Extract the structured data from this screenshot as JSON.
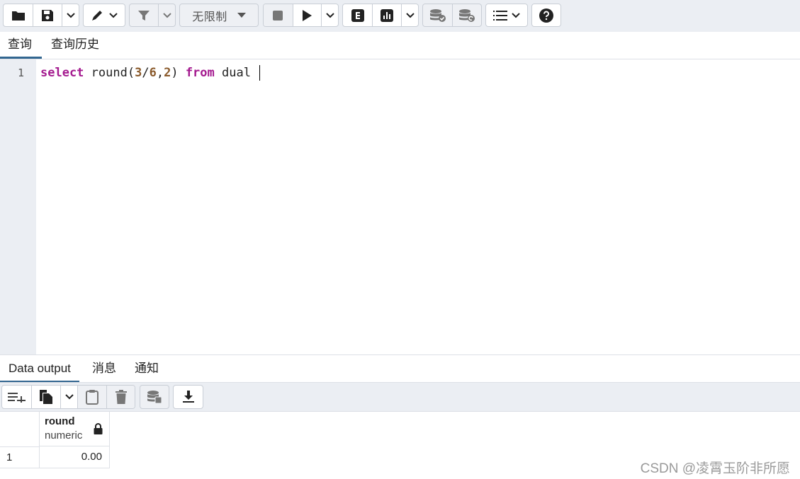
{
  "toolbar": {
    "limit_label": "无限制",
    "icons": [
      "folder-icon",
      "save-icon",
      "chevron-down-icon",
      "pencil-icon",
      "filter-icon",
      "stop-icon",
      "play-icon",
      "explain-icon",
      "analyze-icon",
      "commit-icon",
      "rollback-icon",
      "macros-icon",
      "help-icon"
    ]
  },
  "query_tabs": [
    {
      "label": "查询",
      "active": true
    },
    {
      "label": "查询历史",
      "active": false
    }
  ],
  "editor": {
    "line_number": "1",
    "tokens": {
      "kw_select": "select",
      "fn": " round(",
      "n1": "3",
      "slash": "/",
      "n2": "6",
      "comma": ",",
      "n3": "2",
      "close": ") ",
      "kw_from": "from",
      "table": " dual "
    }
  },
  "output_tabs": [
    {
      "label": "Data output",
      "active": true
    },
    {
      "label": "消息",
      "active": false
    },
    {
      "label": "通知",
      "active": false
    }
  ],
  "result": {
    "column": {
      "name": "round",
      "type": "numeric"
    },
    "rows": [
      {
        "num": "1",
        "value": "0.00"
      }
    ]
  },
  "watermark": "CSDN @凌霄玉阶非所愿"
}
